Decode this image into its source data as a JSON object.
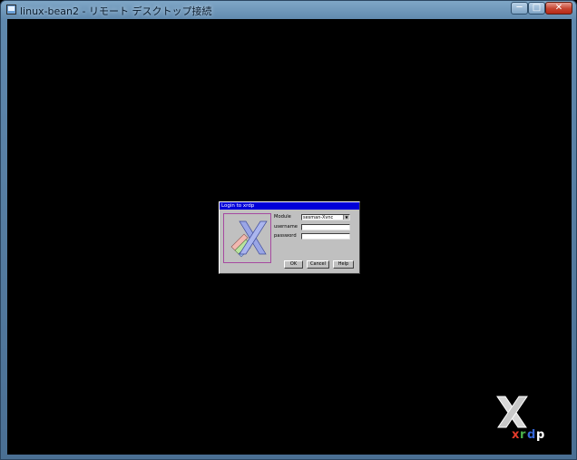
{
  "window": {
    "title": "linux-bean2 - リモート デスクトップ接続",
    "controls": {
      "minimize": "─",
      "maximize": "□",
      "close": "✕"
    }
  },
  "login_dialog": {
    "title": "Login to xrdp",
    "module_label": "Module",
    "module_value": "sesman-Xvnc",
    "username_label": "username",
    "username_value": "",
    "password_label": "password",
    "password_value": "",
    "buttons": {
      "ok": "OK",
      "cancel": "Cancel",
      "help": "Help"
    }
  },
  "branding": {
    "product": "xrdp"
  },
  "colors": {
    "dialog_title_bg": "#0000d8",
    "dialog_bg": "#c0c0c0",
    "screen_bg": "#000000"
  }
}
